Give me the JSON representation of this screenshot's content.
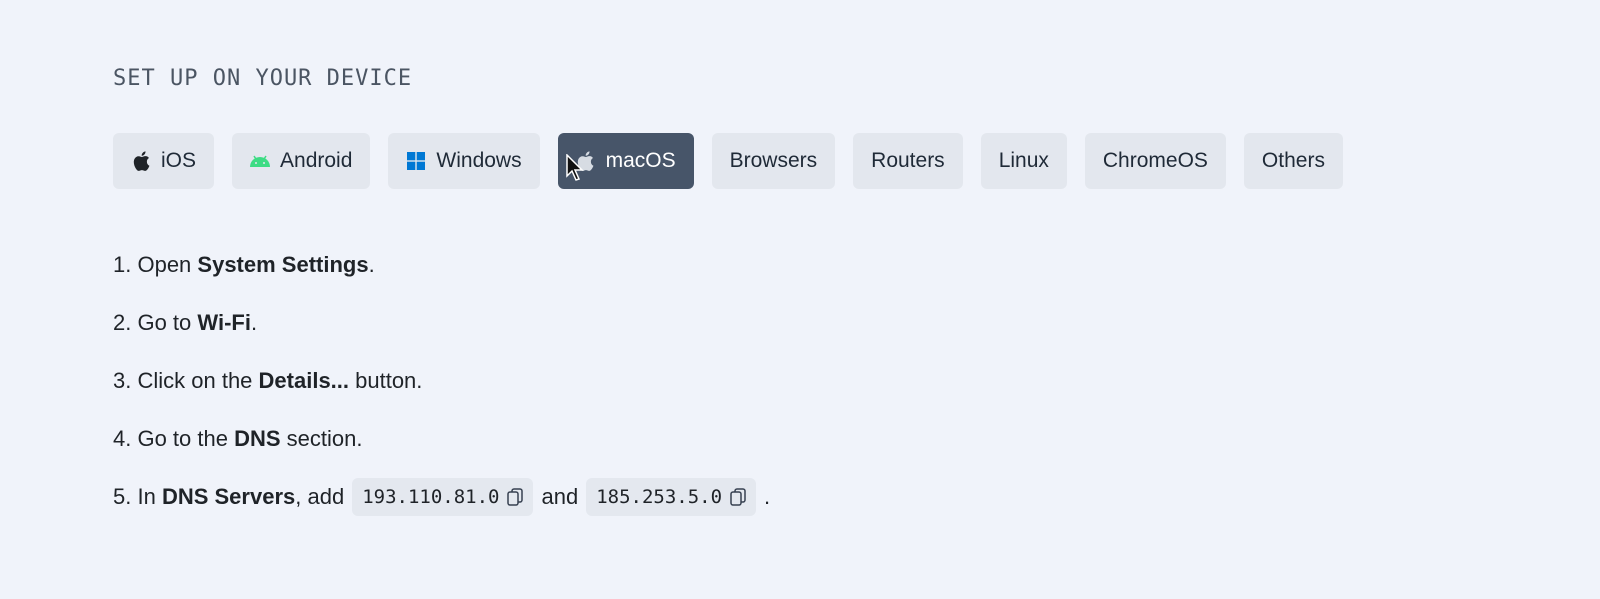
{
  "heading": "SET UP ON YOUR DEVICE",
  "tabs": [
    {
      "label": "iOS",
      "icon": "apple-icon"
    },
    {
      "label": "Android",
      "icon": "android-icon"
    },
    {
      "label": "Windows",
      "icon": "windows-icon"
    },
    {
      "label": "macOS",
      "icon": "apple-icon",
      "active": true
    },
    {
      "label": "Browsers"
    },
    {
      "label": "Routers"
    },
    {
      "label": "Linux"
    },
    {
      "label": "ChromeOS"
    },
    {
      "label": "Others"
    }
  ],
  "steps": {
    "s1": {
      "num": "1.",
      "pre": " Open ",
      "bold": "System Settings",
      "post": "."
    },
    "s2": {
      "num": "2.",
      "pre": " Go to ",
      "bold": "Wi-Fi",
      "post": "."
    },
    "s3": {
      "num": "3.",
      "pre": " Click on the ",
      "bold": "Details...",
      "post": " button."
    },
    "s4": {
      "num": "4.",
      "pre": " Go to the ",
      "bold": "DNS",
      "post": " section."
    },
    "s5": {
      "num": "5.",
      "pre": " In ",
      "bold": "DNS Servers",
      "mid": ", add",
      "dns1": "193.110.81.0",
      "and": "and",
      "dns2": "185.253.5.0",
      "post": "."
    }
  },
  "colors": {
    "background": "#f0f3fa",
    "tab": "#e3e7ee",
    "tab_active": "#475569",
    "android": "#3ddc84",
    "windows": "#0078d4"
  }
}
